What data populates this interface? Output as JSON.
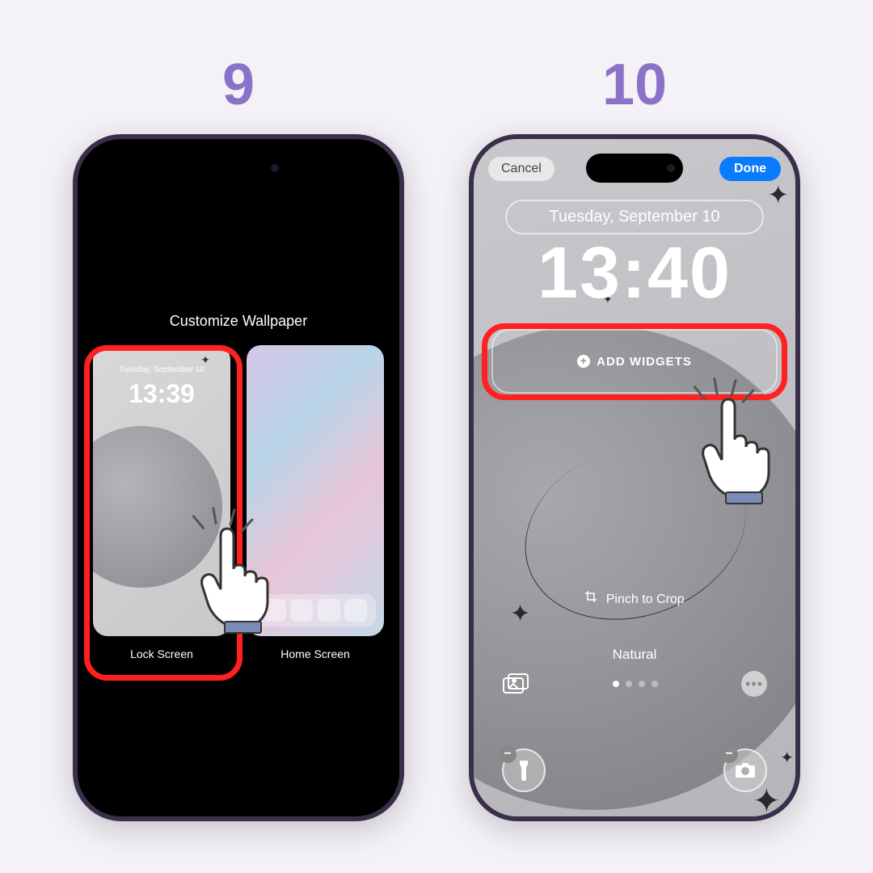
{
  "steps": {
    "step9": {
      "number": "9",
      "title": "Customize Wallpaper",
      "lockscreen": {
        "date": "Tuesday, September 10",
        "time": "13:39",
        "label": "Lock Screen"
      },
      "homescreen": {
        "label": "Home Screen"
      }
    },
    "step10": {
      "number": "10",
      "cancel_label": "Cancel",
      "done_label": "Done",
      "date": "Tuesday, September 10",
      "time": "13:40",
      "add_widgets_label": "ADD WIDGETS",
      "pinch_crop_label": "Pinch to Crop",
      "filter_label": "Natural"
    }
  },
  "colors": {
    "accent": "#8b72c9",
    "highlight": "#ff2020",
    "done_button": "#0a7aff"
  }
}
